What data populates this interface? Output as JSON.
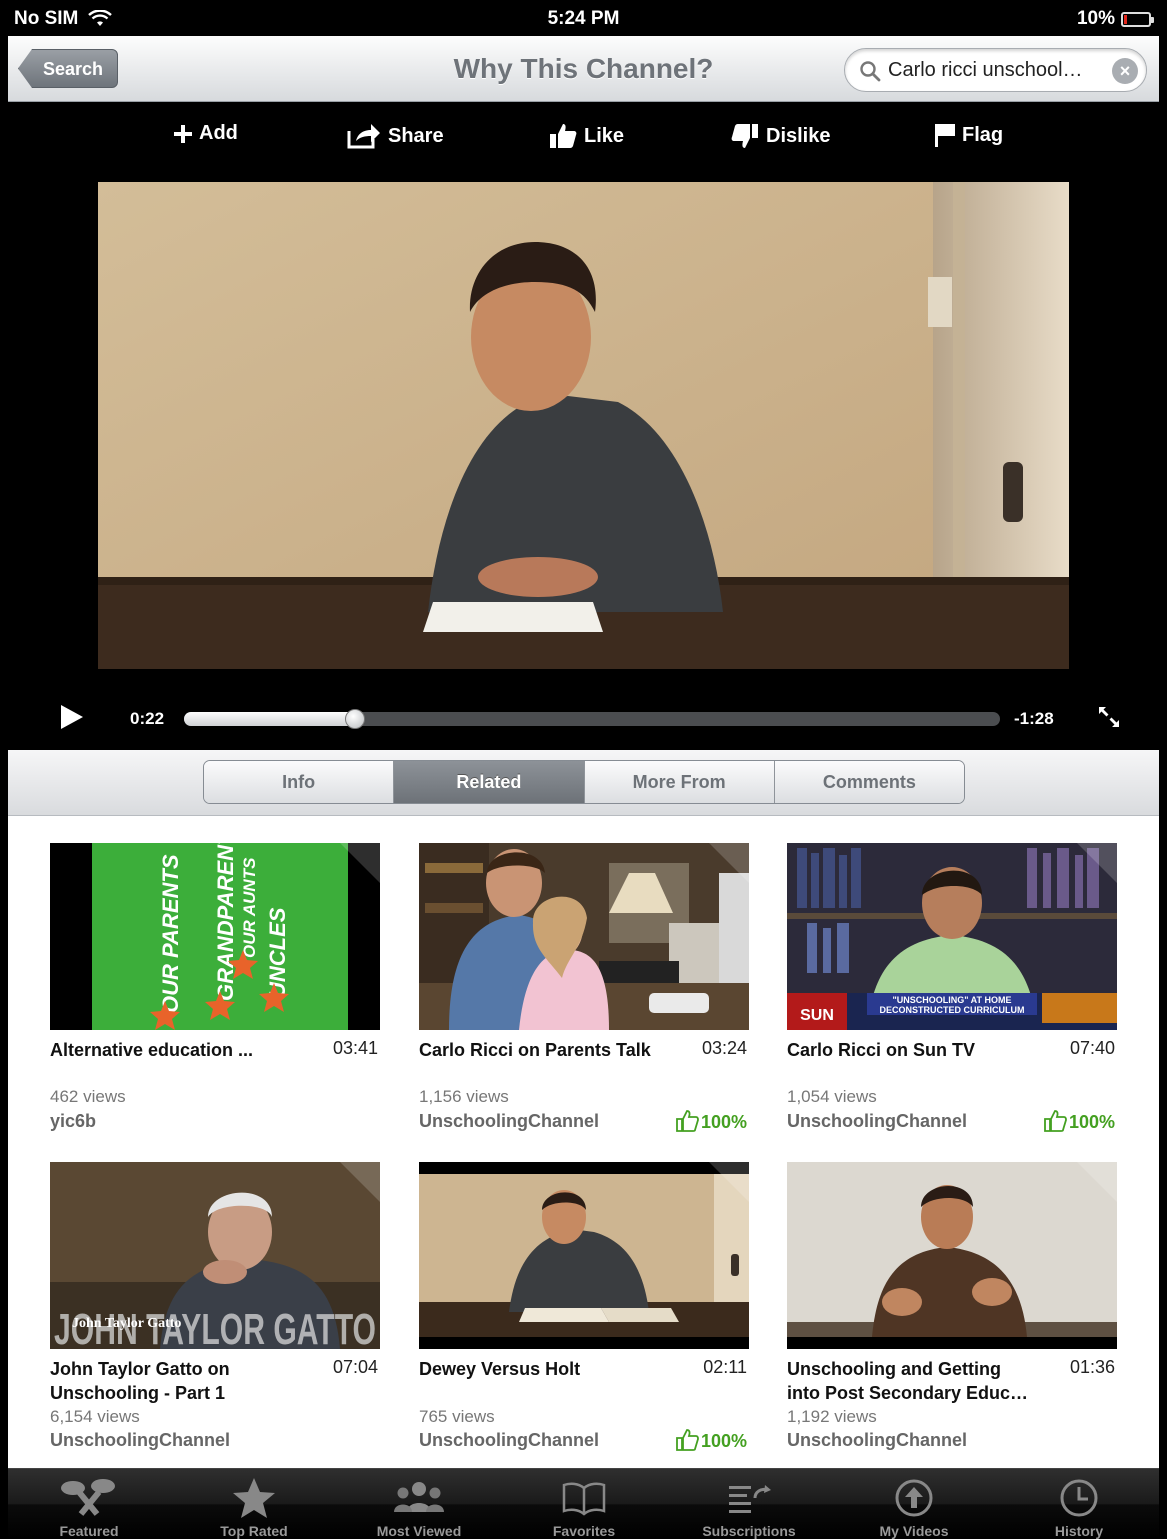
{
  "status_bar": {
    "carrier": "No SIM",
    "time": "5:24 PM",
    "battery_text": "10%",
    "battery_level": 0.1
  },
  "nav": {
    "back_label": "Search",
    "title": "Why This Channel?",
    "search_value": "Carlo ricci unschool…"
  },
  "actions": [
    {
      "label": "Add",
      "icon": "plus-icon"
    },
    {
      "label": "Share",
      "icon": "share-icon"
    },
    {
      "label": "Like",
      "icon": "thumbs-up-icon"
    },
    {
      "label": "Dislike",
      "icon": "thumbs-down-icon"
    },
    {
      "label": "Flag",
      "icon": "flag-icon"
    }
  ],
  "player": {
    "current_time": "0:22",
    "remaining_time": "-1:28",
    "progress": 0.21
  },
  "segments": [
    {
      "label": "Info",
      "active": false
    },
    {
      "label": "Related",
      "active": true
    },
    {
      "label": "More From",
      "active": false
    },
    {
      "label": "Comments",
      "active": false
    }
  ],
  "videos": [
    {
      "title_lines": [
        "Alternative education ..."
      ],
      "duration": "03:41",
      "views": "462 views",
      "author": "yic6b",
      "rating": ""
    },
    {
      "title_lines": [
        "Carlo Ricci on Parents Talk"
      ],
      "duration": "03:24",
      "views": "1,156 views",
      "author": "UnschoolingChannel",
      "rating": "100%"
    },
    {
      "title_lines": [
        "Carlo Ricci on Sun TV"
      ],
      "duration": "07:40",
      "views": "1,054 views",
      "author": "UnschoolingChannel",
      "rating": "100%"
    },
    {
      "title_lines": [
        "John Taylor Gatto on",
        "Unschooling - Part 1"
      ],
      "duration": "07:04",
      "views": "6,154 views",
      "author": "UnschoolingChannel",
      "rating": ""
    },
    {
      "title_lines": [
        "Dewey Versus Holt"
      ],
      "duration": "02:11",
      "views": "765 views",
      "author": "UnschoolingChannel",
      "rating": "100%"
    },
    {
      "title_lines": [
        "Unschooling and Getting",
        "into Post Secondary Educ…"
      ],
      "duration": "01:36",
      "views": "1,192 views",
      "author": "UnschoolingChannel",
      "rating": ""
    }
  ],
  "thumb_text": {
    "t1": [
      "OUR PARENTS",
      "GRANDPARENTS",
      "OUR AUNTS",
      "UNCLES"
    ],
    "t3_banner": "\"UNSCHOOLING\" AT HOME",
    "t3_banner2": "DECONSTRUCTED CURRICULUM",
    "t3_logo": "SUN",
    "t4_big": "JOHN TAYLOR GATTO",
    "t4_small": "John Taylor Gatto"
  },
  "tabs": [
    {
      "label": "Featured",
      "icon": "featured-icon"
    },
    {
      "label": "Top Rated",
      "icon": "star-icon"
    },
    {
      "label": "Most Viewed",
      "icon": "people-icon"
    },
    {
      "label": "Favorites",
      "icon": "book-icon"
    },
    {
      "label": "Subscriptions",
      "icon": "subscriptions-icon"
    },
    {
      "label": "My Videos",
      "icon": "upload-icon"
    },
    {
      "label": "History",
      "icon": "clock-icon"
    }
  ]
}
